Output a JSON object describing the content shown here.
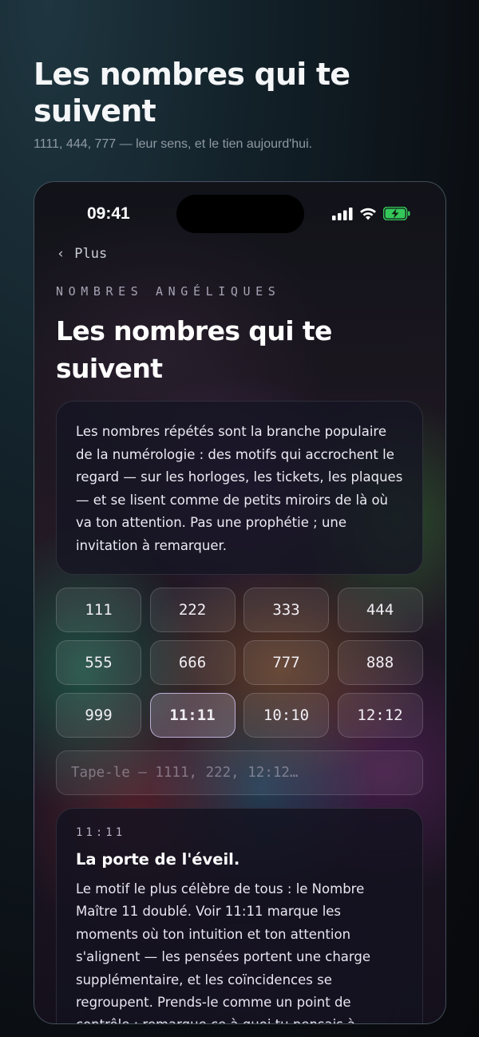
{
  "header": {
    "title": "Les nombres qui te suivent",
    "subtitle": "1111, 444, 777 — leur sens, et le tien aujourd'hui."
  },
  "status_bar": {
    "time": "09:41",
    "icons": [
      "signal-icon",
      "wifi-icon",
      "battery-charging-icon"
    ],
    "battery_color": "#34c759"
  },
  "nav": {
    "back_label": "Plus",
    "back_icon": "chevron-left-icon"
  },
  "screen": {
    "eyebrow": "NOMBRES ANGÉLIQUES",
    "title": "Les nombres qui te suivent",
    "intro": "Les nombres répétés sont la branche populaire de la numérologie : des motifs qui accrochent le regard — sur les horloges, les tickets, les plaques — et se lisent comme de petits miroirs de là où va ton attention. Pas une prophétie ; une invitation à remarquer."
  },
  "numbers": [
    "111",
    "222",
    "333",
    "444",
    "555",
    "666",
    "777",
    "888",
    "999",
    "11:11",
    "10:10",
    "12:12"
  ],
  "selected_number": "11:11",
  "search": {
    "placeholder": "Tape-le — 1111, 222, 12:12…",
    "value": ""
  },
  "detail": {
    "number": "11:11",
    "title": "La porte de l'éveil.",
    "body": "Le motif le plus célèbre de tous : le Nombre Maître 11 doublé. Voir 11:11 marque les moments où ton intuition et ton attention s'alignent — les pensées portent une charge supplémentaire, et les coïncidences se regroupent. Prends-le comme un point de contrôle : remarque ce à quoi tu pensais à l'instant où tu l'as vu. Cette"
  }
}
